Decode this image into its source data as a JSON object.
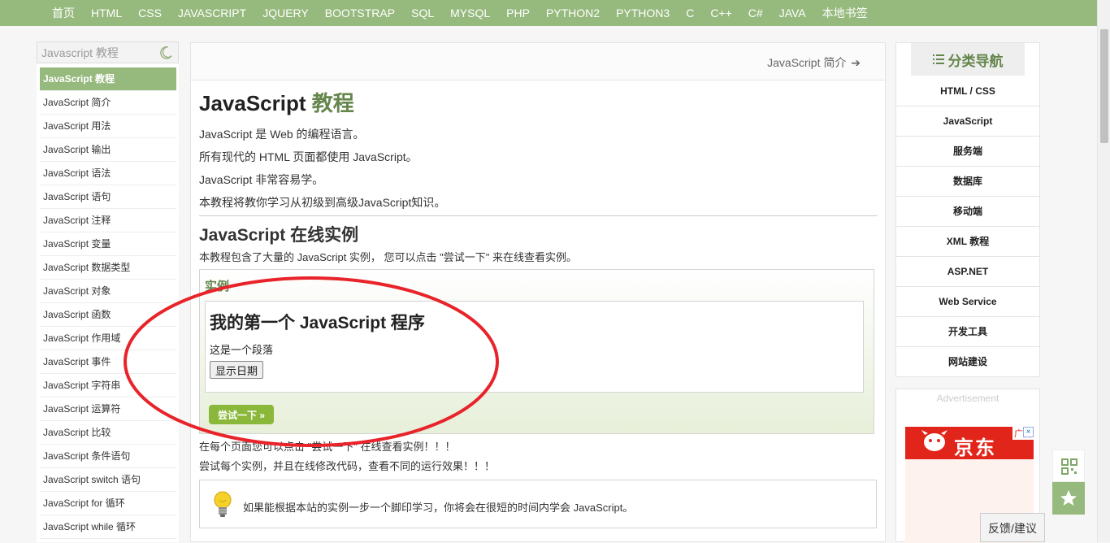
{
  "topnav": [
    "首页",
    "HTML",
    "CSS",
    "JAVASCRIPT",
    "JQUERY",
    "BOOTSTRAP",
    "SQL",
    "MYSQL",
    "PHP",
    "PYTHON2",
    "PYTHON3",
    "C",
    "C++",
    "C#",
    "JAVA",
    "本地书签"
  ],
  "sidebar": {
    "search_placeholder": "Javascript 教程",
    "items": [
      "JavaScript 教程",
      "JavaScript 简介",
      "JavaScript 用法",
      "JavaScript 输出",
      "JavaScript 语法",
      "JavaScript 语句",
      "JavaScript 注释",
      "JavaScript 变量",
      "JavaScript 数据类型",
      "JavaScript 对象",
      "JavaScript 函数",
      "JavaScript 作用域",
      "JavaScript 事件",
      "JavaScript 字符串",
      "JavaScript 运算符",
      "JavaScript 比较",
      "JavaScript 条件语句",
      "JavaScript switch 语句",
      "JavaScript for 循环",
      "JavaScript while 循环"
    ]
  },
  "main": {
    "next_link": "JavaScript 简介",
    "title_prefix": "JavaScript ",
    "title_highlight": "教程",
    "paragraphs": [
      "JavaScript 是 Web 的编程语言。",
      "所有现代的 HTML 页面都使用 JavaScript。",
      "JavaScript 非常容易学。",
      "本教程将教你学习从初级到高级JavaScript知识。"
    ],
    "section_title": "JavaScript 在线实例",
    "section_intro": "本教程包含了大量的 JavaScript 实例， 您可以点击 \"尝试一下\" 来在线查看实例。",
    "example": {
      "label": "实例",
      "heading": "我的第一个 JavaScript 程序",
      "paragraph": "这是一个段落",
      "button": "显示日期",
      "try_button": "尝试一下 »"
    },
    "after_lines": [
      "在每个页面您可以点击 \"尝试一下\" 在线查看实例！！！",
      "尝试每个实例，并且在线修改代码，查看不同的运行效果！！！"
    ],
    "tip": "如果能根据本站的实例一步一个脚印学习，你将会在很短的时间内学会 JavaScript。"
  },
  "rightnav": {
    "title": "分类导航",
    "items": [
      "HTML / CSS",
      "JavaScript",
      "服务端",
      "数据库",
      "移动端",
      "XML 教程",
      "ASP.NET",
      "Web Service",
      "开发工具",
      "网站建设"
    ]
  },
  "ad": {
    "label": "Advertisement",
    "brand": "京东",
    "tag": "广告",
    "close": "×"
  },
  "feedback": "反馈/建议",
  "colors": {
    "theme_green": "#96b97d",
    "title_green": "#64854c",
    "annotation_red": "#e8232a",
    "try_button": "#8ab83a"
  }
}
